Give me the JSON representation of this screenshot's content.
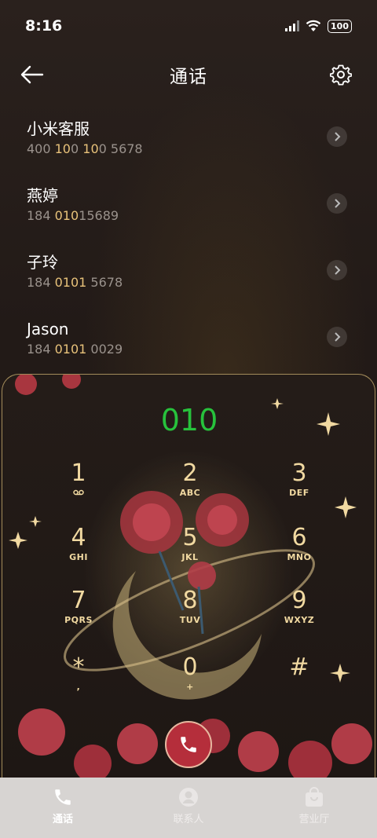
{
  "status_bar": {
    "time": "8:16",
    "battery": "100"
  },
  "header": {
    "title": "通话"
  },
  "recent": [
    {
      "name": "小米客服",
      "number_parts": [
        [
          "400 ",
          false
        ],
        [
          "10",
          true
        ],
        [
          "0",
          false
        ],
        [
          " ",
          false
        ],
        [
          "10",
          true
        ],
        [
          "0 5678",
          false
        ]
      ]
    },
    {
      "name": "燕婷",
      "number_parts": [
        [
          "184 ",
          false
        ],
        [
          "010",
          true
        ],
        [
          "1",
          false
        ],
        [
          "5689",
          false
        ]
      ]
    },
    {
      "name": "子玲",
      "number_parts": [
        [
          "184 ",
          false
        ],
        [
          "0101",
          true
        ],
        [
          " 5678",
          false
        ]
      ]
    },
    {
      "name": "Jason",
      "number_parts": [
        [
          "184 ",
          false
        ],
        [
          "0101",
          true
        ],
        [
          " 0029",
          false
        ]
      ]
    }
  ],
  "dial": {
    "input": "010",
    "keys": [
      {
        "num": "1",
        "letters": "ω"
      },
      {
        "num": "2",
        "letters": "ABC"
      },
      {
        "num": "3",
        "letters": "DEF"
      },
      {
        "num": "4",
        "letters": "GHI"
      },
      {
        "num": "5",
        "letters": "JKL"
      },
      {
        "num": "6",
        "letters": "MNO"
      },
      {
        "num": "7",
        "letters": "PQRS"
      },
      {
        "num": "8",
        "letters": "TUV"
      },
      {
        "num": "9",
        "letters": "WXYZ"
      },
      {
        "num": "*",
        "letters": ","
      },
      {
        "num": "0",
        "letters": "+"
      },
      {
        "num": "#",
        "letters": ""
      }
    ]
  },
  "bottom_nav": {
    "calls": "通话",
    "contacts": "联系人",
    "store": "营业厅"
  },
  "colors": {
    "accent_gold": "#f1d9a1",
    "dial_green": "#27c23c",
    "call_red": "#b52e3b"
  },
  "icons": [
    "back-arrow-icon",
    "gear-icon",
    "chevron-right-icon",
    "phone-icon",
    "person-icon",
    "bag-icon",
    "wifi-icon",
    "signal-icon",
    "voicemail-icon"
  ]
}
